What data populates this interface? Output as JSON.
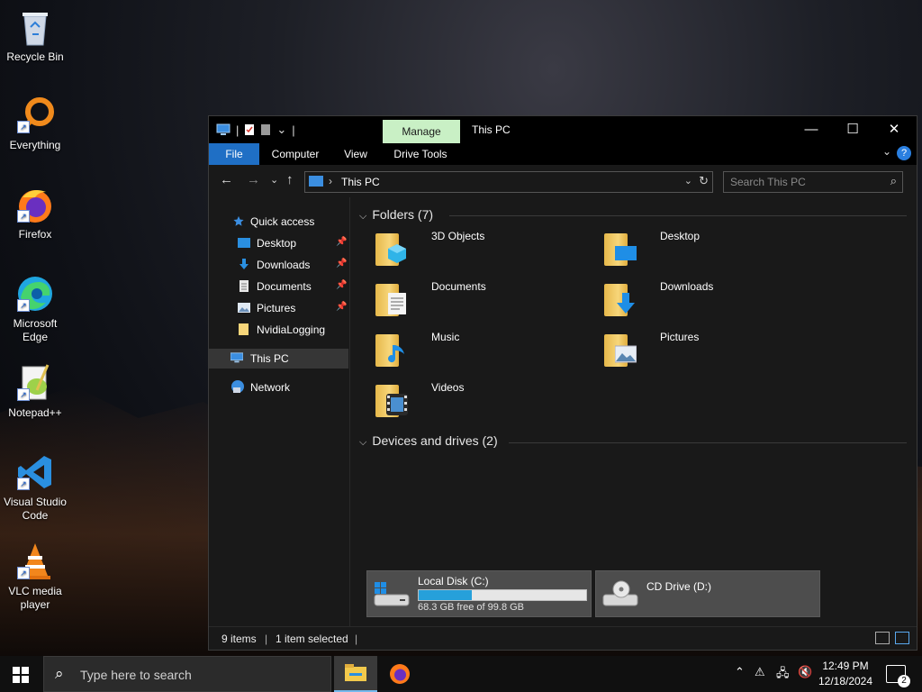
{
  "desktop": {
    "icons": [
      {
        "label": "Recycle Bin"
      },
      {
        "label": "Everything"
      },
      {
        "label": "Firefox"
      },
      {
        "label": "Microsoft Edge"
      },
      {
        "label": "Notepad++"
      },
      {
        "label": "Visual Studio Code"
      },
      {
        "label": "VLC media player"
      }
    ]
  },
  "window": {
    "title": "This PC",
    "manage_tab": "Manage",
    "ribbon_tabs": [
      "File",
      "Computer",
      "View",
      "Drive Tools"
    ],
    "address": "This PC",
    "search_placeholder": "Search This PC"
  },
  "nav": {
    "items": [
      {
        "label": "Quick access"
      },
      {
        "label": "Desktop"
      },
      {
        "label": "Downloads"
      },
      {
        "label": "Documents"
      },
      {
        "label": "Pictures"
      },
      {
        "label": "NvidiaLogging"
      },
      {
        "label": "This PC"
      },
      {
        "label": "Network"
      }
    ]
  },
  "content": {
    "folders_header": "Folders (7)",
    "folders": [
      {
        "label": "3D Objects"
      },
      {
        "label": "Desktop"
      },
      {
        "label": "Documents"
      },
      {
        "label": "Downloads"
      },
      {
        "label": "Music"
      },
      {
        "label": "Pictures"
      },
      {
        "label": "Videos"
      }
    ],
    "drives_header": "Devices and drives (2)",
    "drives": [
      {
        "name": "Local Disk (C:)",
        "free_text": "68.3 GB free of 99.8 GB",
        "used_fraction": 0.316
      },
      {
        "name": "CD Drive (D:)"
      }
    ]
  },
  "status": {
    "items": "9 items",
    "selected": "1 item selected"
  },
  "taskbar": {
    "search_placeholder": "Type here to search",
    "time": "12:49 PM",
    "date": "12/18/2024",
    "notifications": "2"
  },
  "colors": {
    "accent": "#1f6fc5",
    "manage_tab_bg": "#c9f0c5",
    "drive_fill": "#26a0da",
    "folder_yellow": "#f7d67a"
  }
}
